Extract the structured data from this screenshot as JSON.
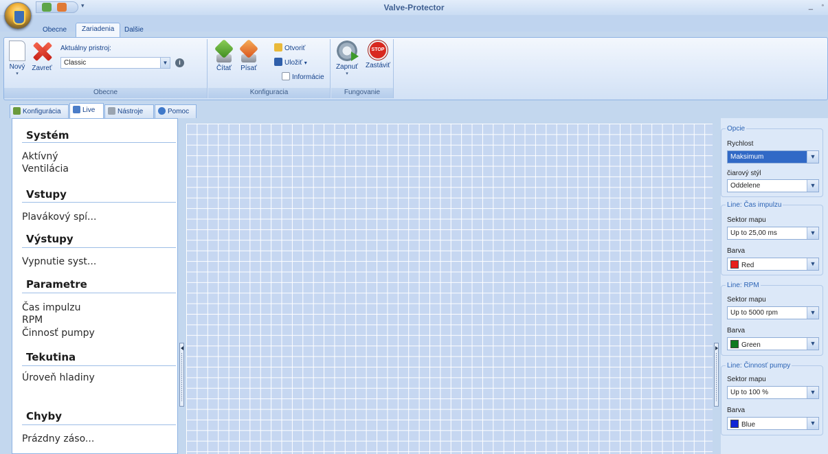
{
  "window": {
    "title": "Valve-Protector",
    "min_glyph": "_",
    "max_glyph": "▫"
  },
  "ribbon": {
    "tabs": [
      "Obecne",
      "Zariadenia",
      "Dalšie"
    ],
    "active_tab": "Zariadenia",
    "groups": {
      "obecne": {
        "label": "Obecne",
        "new_label": "Nový",
        "close_label": "Zavreť",
        "device_label": "Aktuálny pristroj:",
        "device_value": "Classic"
      },
      "konfiguracia": {
        "label": "Konfiguracia",
        "read_label": "Čítať",
        "write_label": "Písať",
        "open_label": "Otvoriť",
        "save_label": "Uložiť",
        "info_label": "Informácie"
      },
      "fungovanie": {
        "label": "Fungovanie",
        "start_label": "Zapnuť",
        "stop_label": "Zastáviť",
        "stop_sign_text": "STOP"
      }
    }
  },
  "doc_tabs": [
    {
      "label": "Konfigurácia",
      "icon": "config-icon"
    },
    {
      "label": "Live",
      "icon": "live-icon"
    },
    {
      "label": "Nástroje",
      "icon": "tools-icon"
    },
    {
      "label": "Pomoc",
      "icon": "help-icon"
    }
  ],
  "active_doc_tab": "Live",
  "left_panel": {
    "system_header": "Systém",
    "system_items": [
      "Aktívný",
      "Ventilácia"
    ],
    "inputs_header": "Vstupy",
    "inputs_items": [
      "Plavákový spí..."
    ],
    "outputs_header": "Výstupy",
    "outputs_items": [
      "Vypnutie syst..."
    ],
    "params_header": "Parametre",
    "params_items": [
      "Čas impulzu",
      "RPM",
      "Činnosť pumpy"
    ],
    "fluid_header": "Tekutina",
    "fluid_items": [
      "Úroveň hladiny"
    ],
    "errors_header": "Chyby",
    "errors_items": [
      "Prázdny záso..."
    ]
  },
  "right_panel": {
    "options": {
      "legend": "Opcie",
      "speed_label": "Rychlost",
      "speed_value": "Maksimum",
      "line_style_label": "čiarový stýl",
      "line_style_value": "Oddelene"
    },
    "line1": {
      "legend": "Line: Čas impulzu",
      "sector_label": "Sektor mapu",
      "sector_value": "Up to 25,00 ms",
      "color_label": "Barva",
      "color_value": "Red",
      "color_hex": "#e8201a"
    },
    "line2": {
      "legend": "Line: RPM",
      "sector_label": "Sektor mapu",
      "sector_value": "Up to 5000 rpm",
      "color_label": "Barva",
      "color_value": "Green",
      "color_hex": "#0f7a1e"
    },
    "line3": {
      "legend": "Line: Činnosť pumpy",
      "sector_label": "Sektor mapu",
      "sector_value": "Up to 100 %",
      "color_label": "Barva",
      "color_value": "Blue",
      "color_hex": "#1025d6"
    }
  },
  "colors": {
    "accent": "#15428b",
    "grid_bg": "#c6d7f1",
    "frame": "#c3d7ee"
  }
}
